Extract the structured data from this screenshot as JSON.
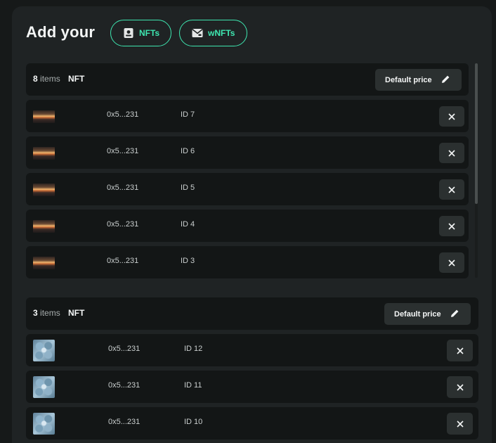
{
  "header": {
    "title": "Add your",
    "tabs": [
      {
        "label": "NFTs",
        "icon": "nft-card-icon"
      },
      {
        "label": "wNFTs",
        "icon": "wnft-envelope-icon"
      }
    ]
  },
  "groups": [
    {
      "count": "8",
      "count_suffix": "items",
      "type": "NFT",
      "price_label": "Default price",
      "items": [
        {
          "address": "0x5...231",
          "id": "ID 7",
          "thumb": "sunset"
        },
        {
          "address": "0x5...231",
          "id": "ID 6",
          "thumb": "sunset"
        },
        {
          "address": "0x5...231",
          "id": "ID 5",
          "thumb": "sunset"
        },
        {
          "address": "0x5...231",
          "id": "ID 4",
          "thumb": "sunset"
        },
        {
          "address": "0x5...231",
          "id": "ID 3",
          "thumb": "sunset"
        }
      ]
    },
    {
      "count": "3",
      "count_suffix": "items",
      "type": "NFT",
      "price_label": "Default price",
      "items": [
        {
          "address": "0x5...231",
          "id": "ID 12",
          "thumb": "ice"
        },
        {
          "address": "0x5...231",
          "id": "ID 11",
          "thumb": "ice"
        },
        {
          "address": "0x5...231",
          "id": "ID 10",
          "thumb": "ice"
        }
      ]
    }
  ],
  "colors": {
    "accent": "#3ee6b0",
    "background": "#161919",
    "panel": "#1f2324",
    "row": "#131616",
    "button": "#2b3030"
  }
}
